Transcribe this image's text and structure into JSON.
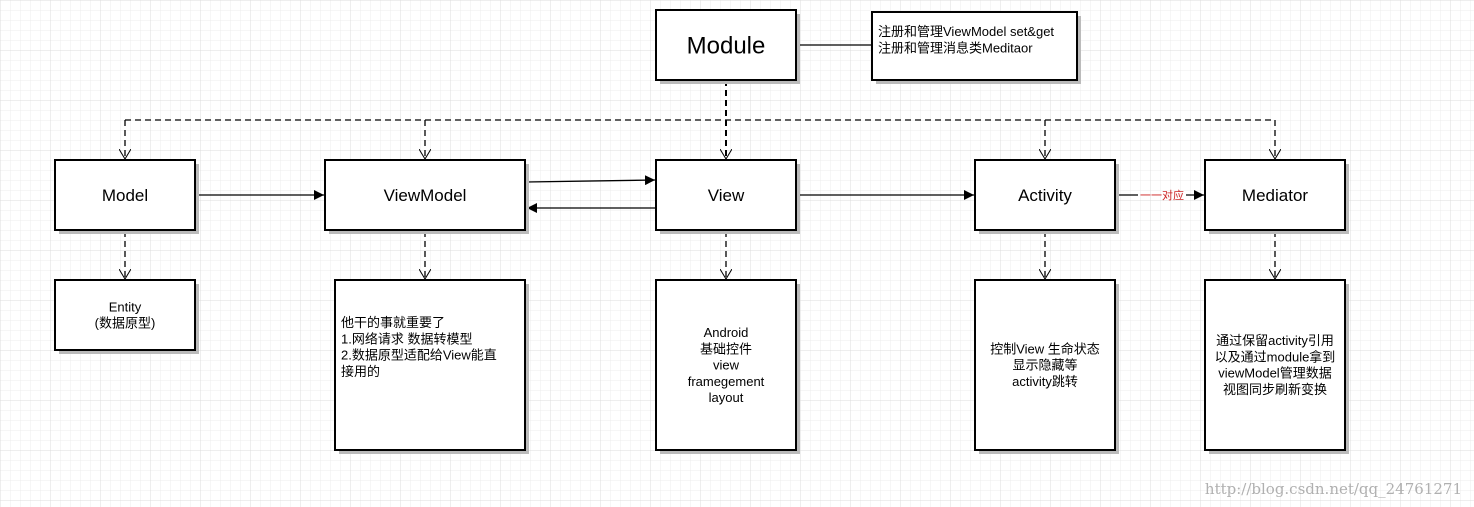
{
  "colors": {
    "line": "#000000",
    "label": "#cc2222",
    "grid": "#e6e6e6",
    "watermark": "#b0b0b0"
  },
  "module": {
    "title": "Module"
  },
  "module_note": {
    "lines": [
      "注册和管理ViewModel set&get",
      "注册和管理消息类Meditaor"
    ]
  },
  "nodes": {
    "model": "Model",
    "viewmodel": "ViewModel",
    "view": "View",
    "activity": "Activity",
    "mediator": "Mediator"
  },
  "details": {
    "model": [
      "Entity",
      "(数据原型)"
    ],
    "viewmodel": [
      "他干的事就重要了",
      "1.网络请求 数据转模型",
      "2.数据原型适配给View能直",
      "接用的"
    ],
    "view": [
      "Android",
      "基础控件",
      "view",
      "framegement",
      "layout"
    ],
    "activity": [
      "控制View 生命状态",
      "显示隐藏等",
      "activity跳转"
    ],
    "mediator": [
      "通过保留activity引用",
      "以及通过module拿到",
      "viewModel管理数据",
      "视图同步刷新变换"
    ]
  },
  "edge_labels": {
    "activity_mediator": "一一对应"
  },
  "watermark": "http://blog.csdn.net/qq_24761271"
}
